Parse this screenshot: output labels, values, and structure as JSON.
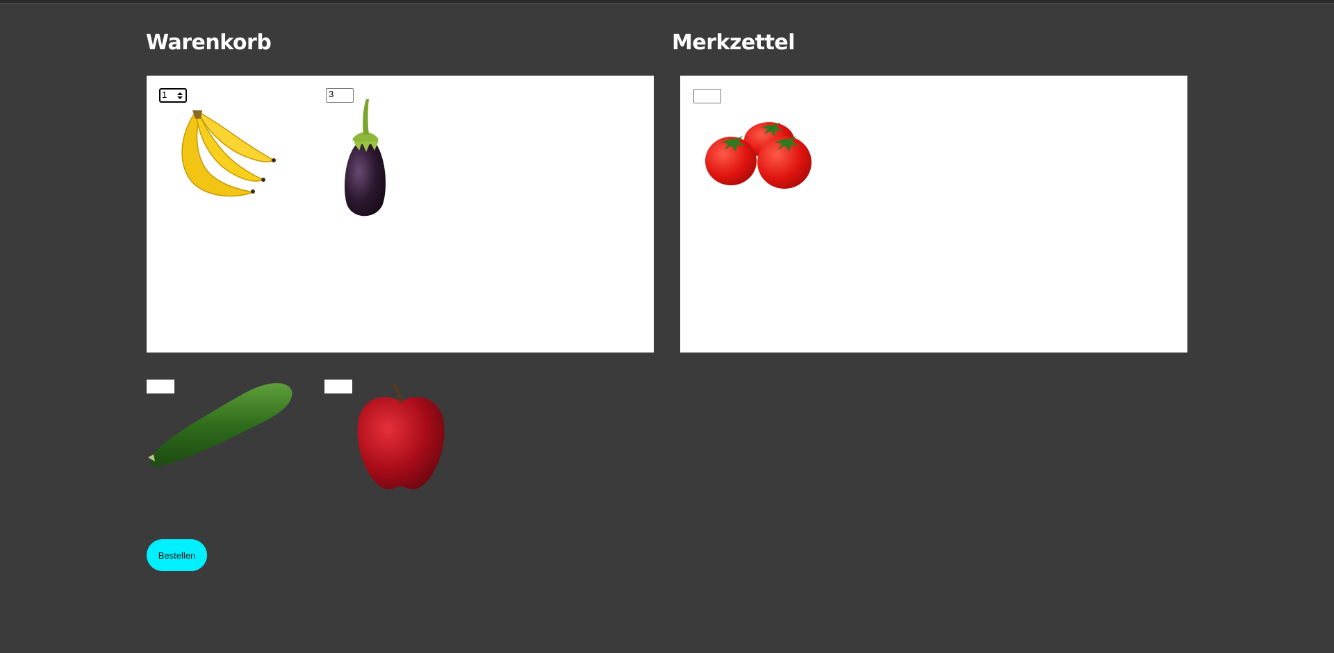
{
  "cart": {
    "title": "Warenkorb",
    "items": [
      {
        "name": "Banane",
        "quantity": "1",
        "icon": "banana-icon"
      },
      {
        "name": "Aubergine",
        "quantity": "3",
        "icon": "eggplant-icon"
      }
    ]
  },
  "wishlist": {
    "title": "Merkzettel",
    "items": [
      {
        "name": "Tomaten",
        "quantity": "",
        "icon": "tomato-icon"
      }
    ]
  },
  "available": {
    "items": [
      {
        "name": "Gurke",
        "quantity": "",
        "icon": "cucumber-icon"
      },
      {
        "name": "Apfel",
        "quantity": "",
        "icon": "apple-icon"
      }
    ]
  },
  "actions": {
    "order_label": "Bestellen",
    "order_color": "#00f0ff"
  },
  "colors": {
    "background": "#3b3b3b",
    "zone": "#ffffff"
  }
}
